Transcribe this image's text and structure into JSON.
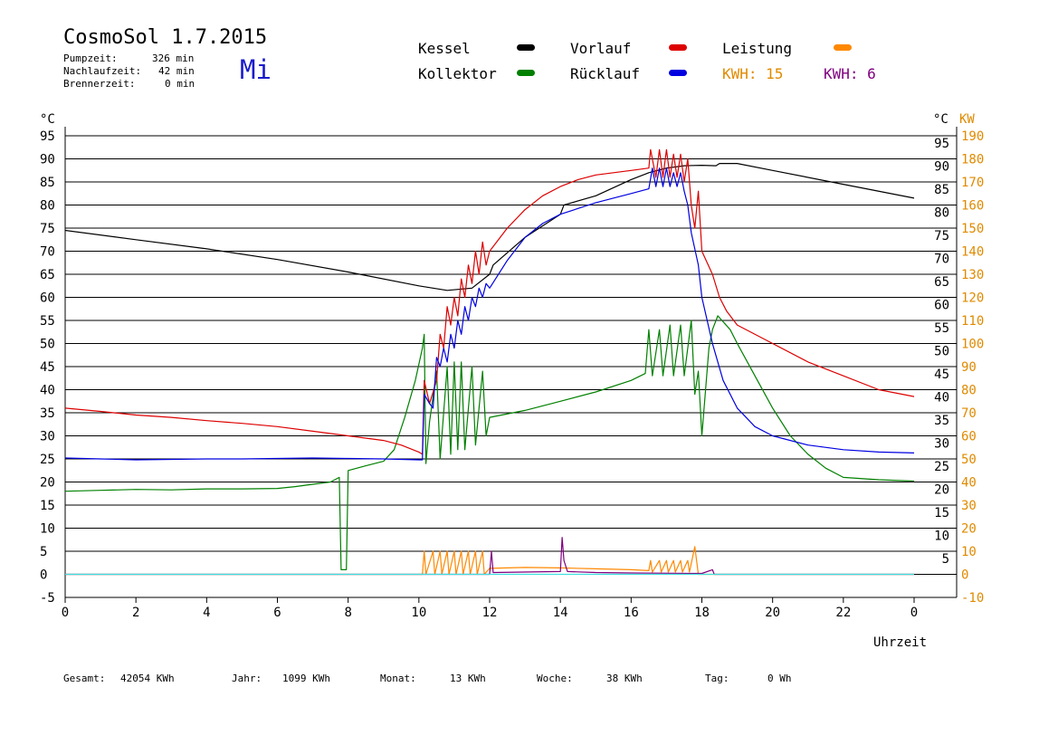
{
  "header": {
    "title": "CosmoSol 1.7.2015",
    "day": "Mi",
    "stats": [
      {
        "label": "Pumpzeit:",
        "value": "326 min"
      },
      {
        "label": "Nachlaufzeit:",
        "value": "42 min"
      },
      {
        "label": "Brennerzeit:",
        "value": "0 min"
      }
    ]
  },
  "legend": {
    "kessel": "Kessel",
    "kollektor": "Kollektor",
    "vorlauf": "Vorlauf",
    "ruecklauf": "Rücklauf",
    "leistung": "Leistung",
    "kwh1_label": "KWH:",
    "kwh1_value": "15",
    "kwh2_label": "KWH:",
    "kwh2_value": "6"
  },
  "colors": {
    "kessel": "#000000",
    "kollektor": "#008000",
    "vorlauf": "#dd0000",
    "ruecklauf": "#0000e0",
    "leistung": "#ff8800",
    "kwh2": "#800080",
    "kw_axis": "#e08a00",
    "baseline": "#40e0e0"
  },
  "footer": {
    "gesamt_label": "Gesamt:",
    "gesamt_value": "42054 KWh",
    "jahr_label": "Jahr:",
    "jahr_value": "1099 KWh",
    "monat_label": "Monat:",
    "monat_value": "13 KWh",
    "woche_label": "Woche:",
    "woche_value": "38 KWh",
    "tag_label": "Tag:",
    "tag_value": "0 Wh"
  },
  "chart_data": {
    "type": "line",
    "xlabel": "Uhrzeit",
    "ylabel_left": "°C",
    "ylabel_right_1": "°C",
    "ylabel_right_2": "KW",
    "xlim": [
      0,
      24
    ],
    "ylim": [
      -5,
      95
    ],
    "x_ticks": [
      0,
      2,
      4,
      6,
      8,
      10,
      12,
      14,
      16,
      18,
      20,
      22,
      24
    ],
    "x_tick_labels": [
      "0",
      "2",
      "4",
      "6",
      "8",
      "10",
      "12",
      "14",
      "16",
      "18",
      "20",
      "22",
      "0"
    ],
    "y_ticks_left": [
      -5,
      0,
      5,
      10,
      15,
      20,
      25,
      30,
      35,
      40,
      45,
      50,
      55,
      60,
      65,
      70,
      75,
      80,
      85,
      90,
      95
    ],
    "y_ticks_right_c": [
      5,
      10,
      15,
      20,
      25,
      30,
      35,
      40,
      45,
      50,
      55,
      60,
      65,
      70,
      75,
      80,
      85,
      90,
      95
    ],
    "y_ticks_right_kw": [
      -10,
      0,
      10,
      20,
      30,
      40,
      50,
      60,
      70,
      80,
      90,
      100,
      110,
      120,
      130,
      140,
      150,
      160,
      170,
      180,
      190
    ],
    "grid": "horizontal",
    "series": [
      {
        "name": "Kessel",
        "color": "#000000",
        "points": [
          [
            0,
            74.5
          ],
          [
            2,
            72.5
          ],
          [
            4,
            70.5
          ],
          [
            6,
            68.2
          ],
          [
            8,
            65.5
          ],
          [
            10,
            62.5
          ],
          [
            10.8,
            61.5
          ],
          [
            11.5,
            62
          ],
          [
            12,
            65
          ],
          [
            12.1,
            67
          ],
          [
            13,
            73
          ],
          [
            14,
            78
          ],
          [
            14.1,
            80
          ],
          [
            15,
            82
          ],
          [
            16,
            85.5
          ],
          [
            16.5,
            87
          ],
          [
            17,
            88
          ],
          [
            17.5,
            88.5
          ],
          [
            18,
            88.6
          ],
          [
            18.4,
            88.5
          ],
          [
            18.5,
            89
          ],
          [
            19,
            89
          ],
          [
            20,
            87.5
          ],
          [
            22,
            84.5
          ],
          [
            24,
            81.5
          ]
        ]
      },
      {
        "name": "Kollektor",
        "color": "#008000",
        "points": [
          [
            0,
            18
          ],
          [
            1,
            18.2
          ],
          [
            2,
            18.4
          ],
          [
            3,
            18.3
          ],
          [
            4,
            18.5
          ],
          [
            5,
            18.5
          ],
          [
            6,
            18.6
          ],
          [
            6.5,
            19
          ],
          [
            7,
            19.5
          ],
          [
            7.5,
            20
          ],
          [
            7.75,
            21
          ],
          [
            7.8,
            1
          ],
          [
            7.95,
            1
          ],
          [
            8,
            22.5
          ],
          [
            8.5,
            23.5
          ],
          [
            9,
            24.5
          ],
          [
            9.3,
            27
          ],
          [
            9.6,
            34
          ],
          [
            9.9,
            42
          ],
          [
            10.1,
            49
          ],
          [
            10.15,
            52
          ],
          [
            10.2,
            24
          ],
          [
            10.3,
            33
          ],
          [
            10.5,
            44
          ],
          [
            10.6,
            25
          ],
          [
            10.8,
            45
          ],
          [
            10.9,
            26
          ],
          [
            11,
            46
          ],
          [
            11.1,
            27
          ],
          [
            11.2,
            46
          ],
          [
            11.3,
            27
          ],
          [
            11.5,
            45
          ],
          [
            11.6,
            28
          ],
          [
            11.8,
            44
          ],
          [
            11.9,
            30
          ],
          [
            12,
            34
          ],
          [
            13,
            35.5
          ],
          [
            14,
            37.5
          ],
          [
            15,
            39.5
          ],
          [
            16,
            42
          ],
          [
            16.4,
            43.5
          ],
          [
            16.5,
            53
          ],
          [
            16.6,
            43
          ],
          [
            16.8,
            53
          ],
          [
            16.9,
            43
          ],
          [
            17.1,
            54
          ],
          [
            17.2,
            43
          ],
          [
            17.4,
            54
          ],
          [
            17.5,
            43
          ],
          [
            17.7,
            55
          ],
          [
            17.8,
            39
          ],
          [
            17.9,
            44
          ],
          [
            18,
            30
          ],
          [
            18.2,
            49
          ],
          [
            18.3,
            53
          ],
          [
            18.45,
            56
          ],
          [
            18.8,
            53
          ],
          [
            19,
            50
          ],
          [
            19.5,
            43
          ],
          [
            20,
            36
          ],
          [
            20.5,
            30
          ],
          [
            21,
            26
          ],
          [
            21.5,
            23
          ],
          [
            22,
            21
          ],
          [
            23,
            20.5
          ],
          [
            24,
            20.2
          ]
        ]
      },
      {
        "name": "Vorlauf",
        "color": "#dd0000",
        "points": [
          [
            0,
            36
          ],
          [
            1,
            35.3
          ],
          [
            2,
            34.5
          ],
          [
            3,
            34
          ],
          [
            4,
            33.3
          ],
          [
            5,
            32.7
          ],
          [
            6,
            32
          ],
          [
            7,
            31
          ],
          [
            8,
            30
          ],
          [
            9,
            29
          ],
          [
            9.5,
            28
          ],
          [
            10,
            26.5
          ],
          [
            10.1,
            26
          ],
          [
            10.15,
            42
          ],
          [
            10.3,
            37
          ],
          [
            10.5,
            42
          ],
          [
            10.6,
            52
          ],
          [
            10.7,
            49
          ],
          [
            10.8,
            58
          ],
          [
            10.9,
            54
          ],
          [
            11,
            60
          ],
          [
            11.1,
            56
          ],
          [
            11.2,
            64
          ],
          [
            11.3,
            60
          ],
          [
            11.4,
            67
          ],
          [
            11.5,
            63
          ],
          [
            11.6,
            70
          ],
          [
            11.7,
            65
          ],
          [
            11.8,
            72
          ],
          [
            11.9,
            67
          ],
          [
            12,
            70
          ],
          [
            12.5,
            75
          ],
          [
            13,
            79
          ],
          [
            13.5,
            82
          ],
          [
            14,
            84
          ],
          [
            14.5,
            85.5
          ],
          [
            15,
            86.5
          ],
          [
            16,
            87.5
          ],
          [
            16.5,
            88
          ],
          [
            16.55,
            92
          ],
          [
            16.7,
            86
          ],
          [
            16.8,
            92
          ],
          [
            16.9,
            86
          ],
          [
            17,
            92
          ],
          [
            17.1,
            86
          ],
          [
            17.2,
            91
          ],
          [
            17.3,
            86
          ],
          [
            17.4,
            91
          ],
          [
            17.5,
            85
          ],
          [
            17.6,
            90
          ],
          [
            17.7,
            80
          ],
          [
            17.8,
            75
          ],
          [
            17.9,
            83
          ],
          [
            18,
            70
          ],
          [
            18.3,
            65
          ],
          [
            18.5,
            60
          ],
          [
            18.7,
            57
          ],
          [
            19,
            54
          ],
          [
            20,
            50
          ],
          [
            21,
            46
          ],
          [
            22,
            43
          ],
          [
            23,
            40
          ],
          [
            24,
            38.5
          ]
        ]
      },
      {
        "name": "Rücklauf",
        "color": "#0000e0",
        "points": [
          [
            0,
            25.2
          ],
          [
            1,
            25
          ],
          [
            2,
            24.8
          ],
          [
            3,
            24.9
          ],
          [
            4,
            25
          ],
          [
            5,
            25
          ],
          [
            6,
            25.1
          ],
          [
            7,
            25.2
          ],
          [
            8,
            25.1
          ],
          [
            9,
            25
          ],
          [
            10,
            24.8
          ],
          [
            10.1,
            24.8
          ],
          [
            10.15,
            39
          ],
          [
            10.3,
            37
          ],
          [
            10.4,
            36
          ],
          [
            10.5,
            47
          ],
          [
            10.6,
            45
          ],
          [
            10.7,
            49
          ],
          [
            10.8,
            46
          ],
          [
            10.9,
            52
          ],
          [
            11,
            49
          ],
          [
            11.1,
            55
          ],
          [
            11.2,
            52
          ],
          [
            11.3,
            58
          ],
          [
            11.4,
            55
          ],
          [
            11.5,
            60
          ],
          [
            11.6,
            58
          ],
          [
            11.7,
            62
          ],
          [
            11.8,
            60
          ],
          [
            11.9,
            63
          ],
          [
            12,
            62
          ],
          [
            12.5,
            68
          ],
          [
            13,
            73
          ],
          [
            13.5,
            76
          ],
          [
            14,
            78
          ],
          [
            15,
            80.5
          ],
          [
            16,
            82.5
          ],
          [
            16.5,
            83.5
          ],
          [
            16.6,
            88
          ],
          [
            16.7,
            84
          ],
          [
            16.8,
            88
          ],
          [
            16.9,
            84
          ],
          [
            17,
            88
          ],
          [
            17.1,
            84
          ],
          [
            17.2,
            87
          ],
          [
            17.3,
            84
          ],
          [
            17.4,
            87
          ],
          [
            17.5,
            83
          ],
          [
            17.6,
            80
          ],
          [
            17.7,
            74
          ],
          [
            17.9,
            67
          ],
          [
            18,
            60
          ],
          [
            18.3,
            50
          ],
          [
            18.6,
            42
          ],
          [
            19,
            36
          ],
          [
            19.5,
            32
          ],
          [
            20,
            30
          ],
          [
            21,
            28
          ],
          [
            22,
            27
          ],
          [
            23,
            26.5
          ],
          [
            24,
            26.3
          ]
        ]
      },
      {
        "name": "Leistung",
        "color": "#ff8800",
        "points": [
          [
            0,
            0
          ],
          [
            10.1,
            0
          ],
          [
            10.15,
            5
          ],
          [
            10.2,
            0
          ],
          [
            10.4,
            5
          ],
          [
            10.45,
            0
          ],
          [
            10.6,
            5
          ],
          [
            10.65,
            0
          ],
          [
            10.8,
            5
          ],
          [
            10.85,
            0
          ],
          [
            11,
            5
          ],
          [
            11.05,
            0
          ],
          [
            11.2,
            5
          ],
          [
            11.25,
            0
          ],
          [
            11.4,
            5
          ],
          [
            11.45,
            0
          ],
          [
            11.6,
            5
          ],
          [
            11.65,
            0
          ],
          [
            11.8,
            5
          ],
          [
            11.85,
            0
          ],
          [
            12,
            1.3
          ],
          [
            13,
            1.5
          ],
          [
            14,
            1.4
          ],
          [
            15,
            1.2
          ],
          [
            16,
            1
          ],
          [
            16.5,
            0.8
          ],
          [
            16.55,
            3
          ],
          [
            16.6,
            0.5
          ],
          [
            16.8,
            3
          ],
          [
            16.85,
            0.5
          ],
          [
            17,
            3
          ],
          [
            17.05,
            0.5
          ],
          [
            17.2,
            3
          ],
          [
            17.25,
            0.5
          ],
          [
            17.4,
            3
          ],
          [
            17.45,
            0.5
          ],
          [
            17.6,
            3
          ],
          [
            17.65,
            0.5
          ],
          [
            17.8,
            6
          ],
          [
            17.9,
            0
          ],
          [
            24,
            0
          ]
        ]
      },
      {
        "name": "KWH 6",
        "color": "#800080",
        "points": [
          [
            0,
            0
          ],
          [
            12,
            0
          ],
          [
            12.05,
            5
          ],
          [
            12.1,
            0.4
          ],
          [
            14,
            0.6
          ],
          [
            14.05,
            8
          ],
          [
            14.1,
            3
          ],
          [
            14.2,
            0.6
          ],
          [
            15,
            0.4
          ],
          [
            16,
            0.3
          ],
          [
            18,
            0.2
          ],
          [
            18.3,
            1
          ],
          [
            18.35,
            0
          ],
          [
            24,
            0
          ]
        ]
      },
      {
        "name": "Baseline",
        "color": "#40e0e0",
        "points": [
          [
            0,
            0
          ],
          [
            24,
            0
          ]
        ]
      }
    ]
  }
}
